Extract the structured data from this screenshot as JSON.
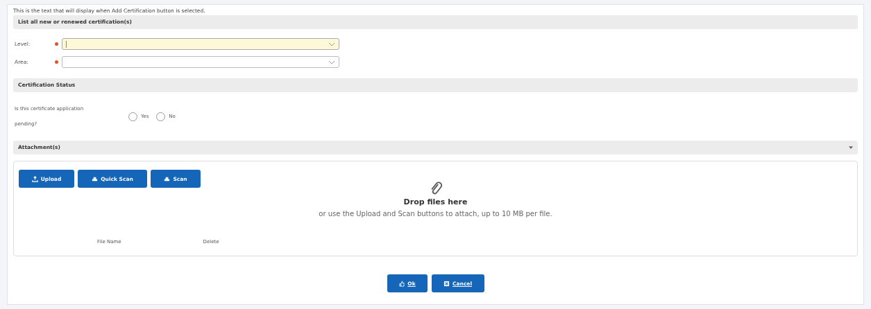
{
  "intro": "This is the text that will display when Add Certification button is selected.",
  "certifications_section": {
    "title": "List all new or renewed certification(s)"
  },
  "fields": [
    {
      "label": "Level:",
      "required": true,
      "focused": true
    },
    {
      "label": "Area:",
      "required": true,
      "focused": false
    }
  ],
  "status_section": {
    "title": "Certification Status"
  },
  "question": {
    "label": "Is this certificate application pending?",
    "options": [
      {
        "label": "Yes",
        "selected": false
      },
      {
        "label": "No",
        "selected": false
      }
    ]
  },
  "attachments": {
    "title": "Attachment(s)",
    "expanded": true,
    "buttons": [
      {
        "kind": "upload",
        "label": "Upload"
      },
      {
        "kind": "scan",
        "label": "Quick Scan"
      },
      {
        "kind": "scan",
        "label": "Scan"
      }
    ],
    "drop_title": "Drop files here",
    "drop_hint": "or use the Upload and Scan buttons to attach, up to 10 MB per file.",
    "columns": [
      "File Name",
      "Delete"
    ]
  },
  "footer_buttons": [
    {
      "kind": "ok",
      "label": "Ok"
    },
    {
      "kind": "cancel",
      "label": "Cancel"
    }
  ]
}
